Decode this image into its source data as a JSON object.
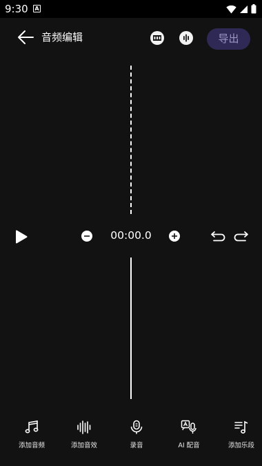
{
  "status_bar": {
    "time": "9:30",
    "notification_letter": "A"
  },
  "toolbar": {
    "title": "音频编辑",
    "export_label": "导出"
  },
  "playback": {
    "time": "00:00.0"
  },
  "bottom_nav": {
    "items": [
      {
        "label": "添加音频",
        "icon": "music-note-icon"
      },
      {
        "label": "添加音效",
        "icon": "sound-wave-icon"
      },
      {
        "label": "录音",
        "icon": "microphone-icon"
      },
      {
        "label": "AI 配音",
        "icon": "ai-dubbing-icon"
      },
      {
        "label": "添加乐段",
        "icon": "music-segment-icon"
      }
    ]
  },
  "colors": {
    "background": "#121212",
    "export_button_bg": "#2f2a55",
    "export_button_text": "#9c98c6"
  }
}
